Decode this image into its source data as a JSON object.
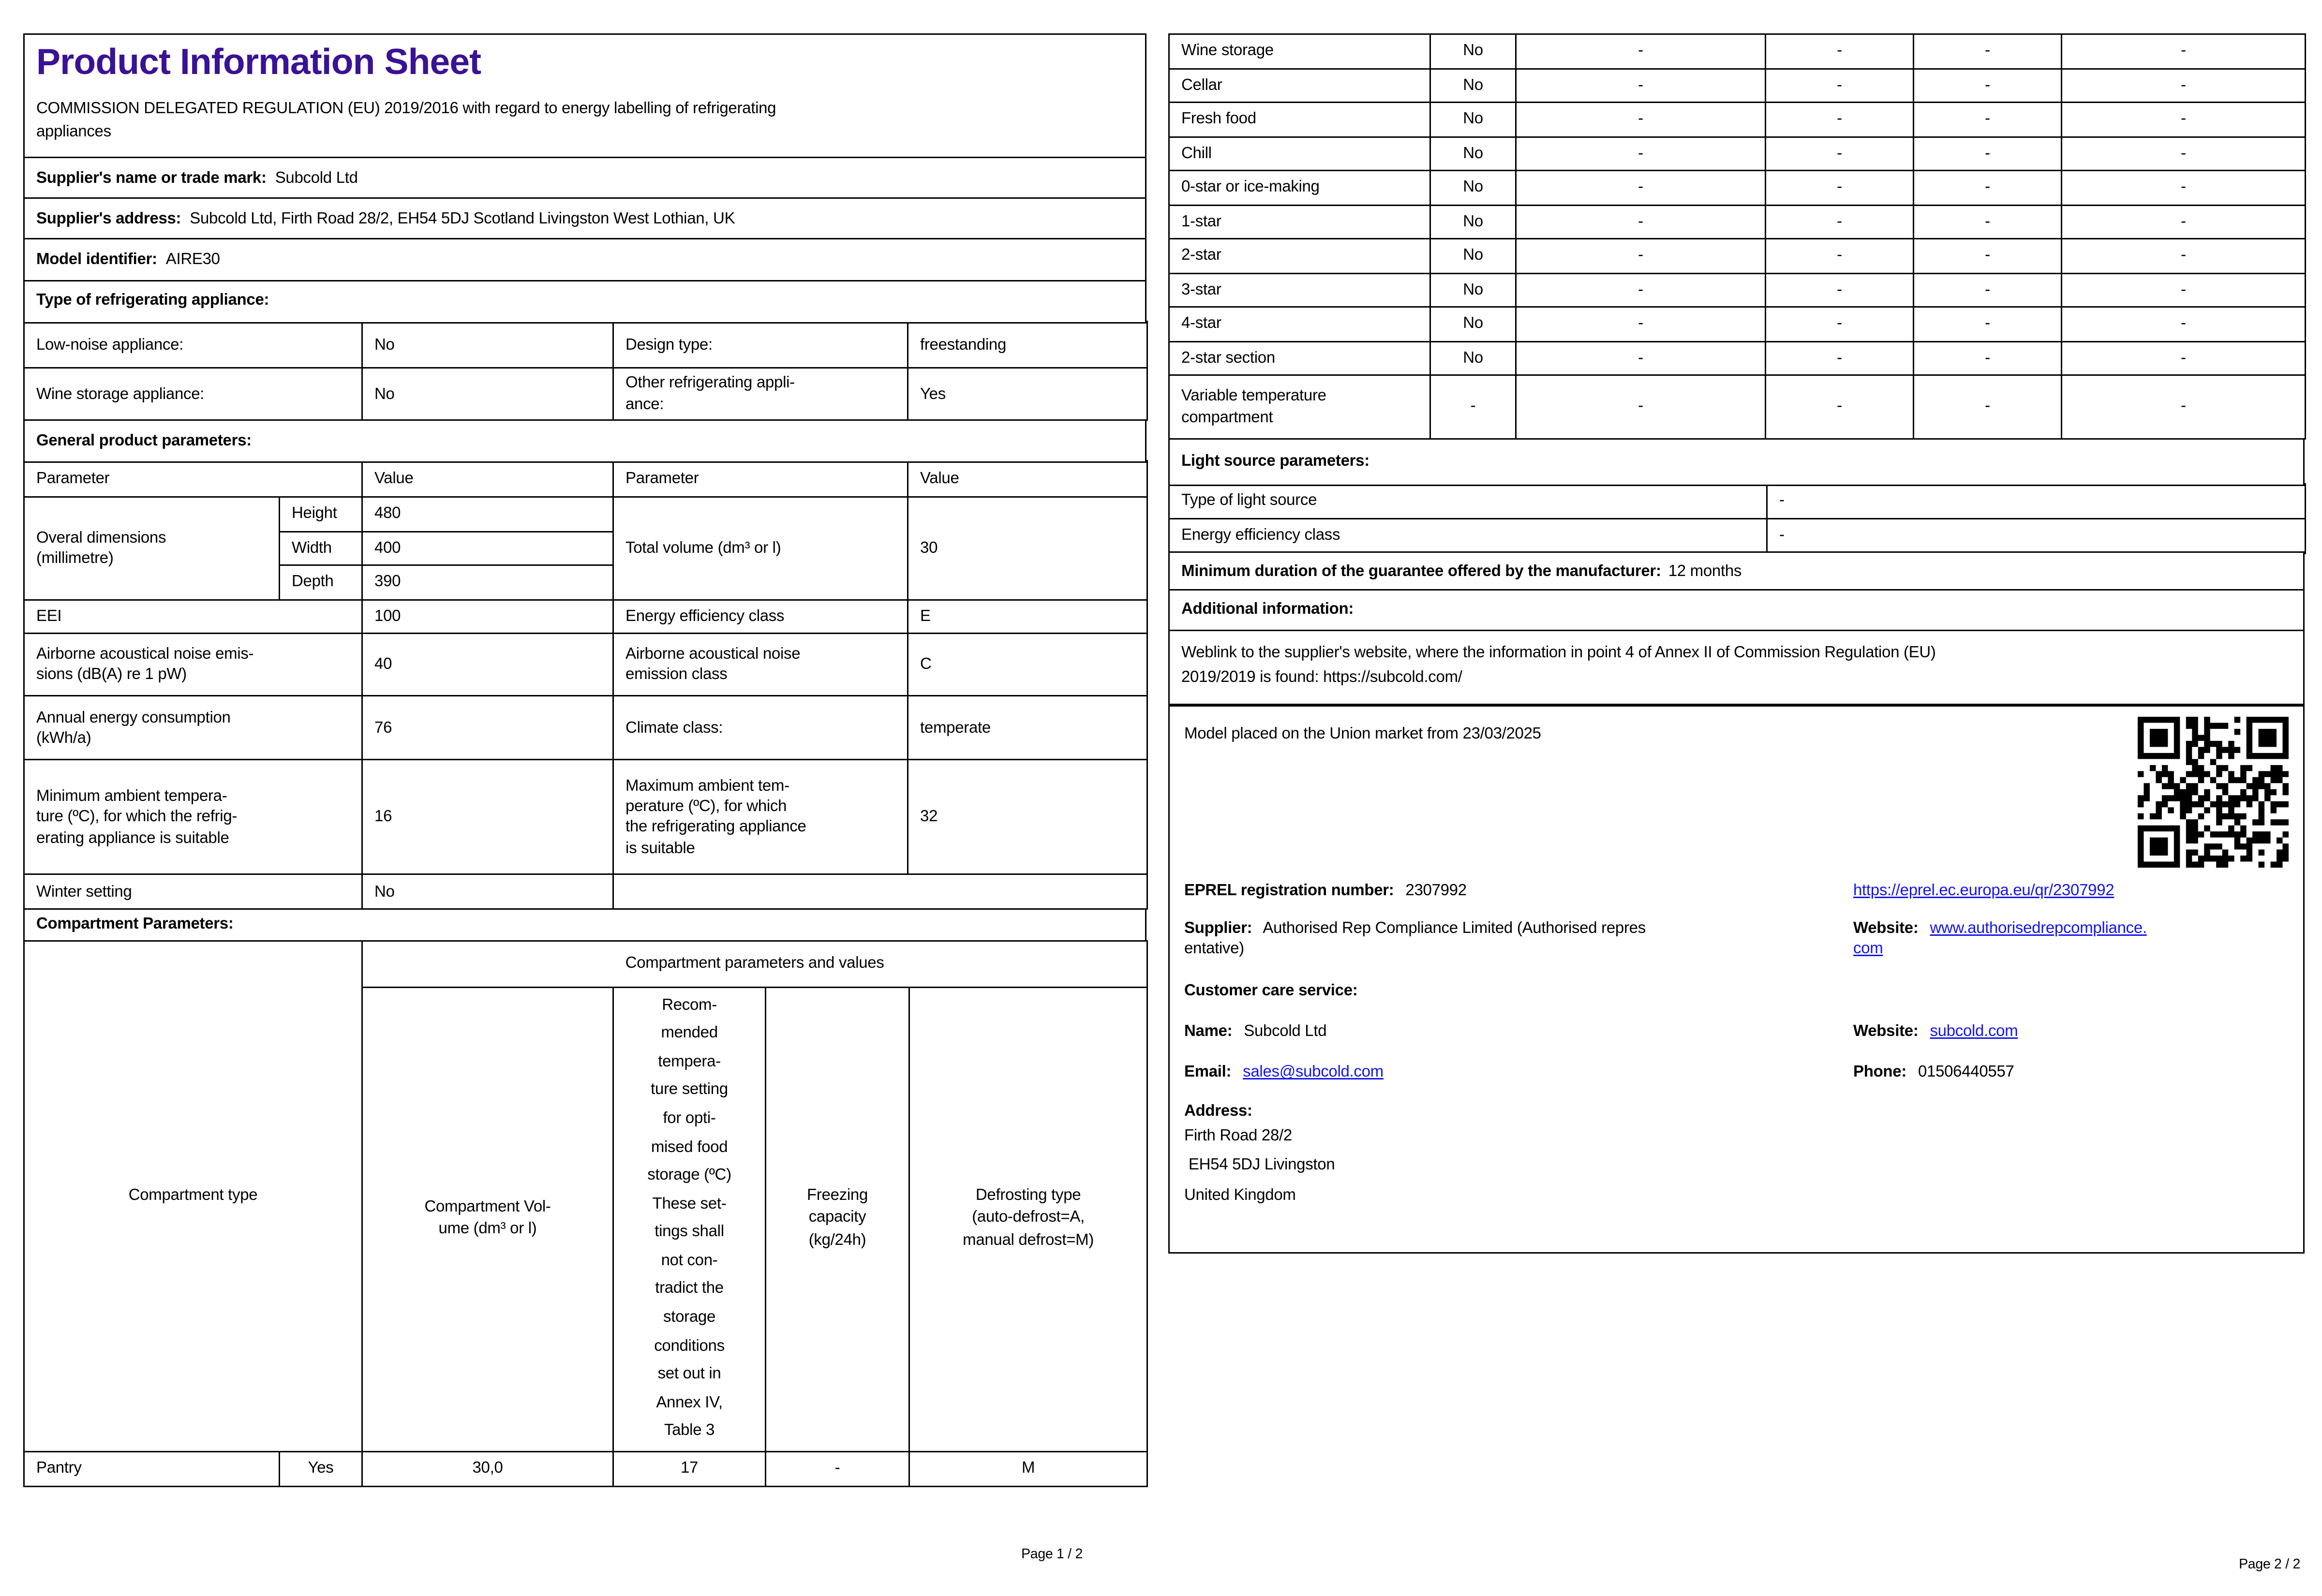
{
  "colors": {
    "title": "#3a1295",
    "link": "#1414ee",
    "border": "#000000"
  },
  "page1": {
    "title": "Product Information Sheet",
    "regulation": "COMMISSION DELEGATED REGULATION (EU) 2019/2016 with regard to energy labelling of refrigerating\nappliances",
    "supplier_name": {
      "label": "Supplier's name or trade mark:",
      "value": "Subcold Ltd"
    },
    "supplier_address": {
      "label": "Supplier's address:",
      "value": "Subcold Ltd, Firth Road 28/2, EH54 5DJ Scotland Livingston West Lothian, UK"
    },
    "model_identifier": {
      "label": "Model identifier:",
      "value": "AIRE30"
    },
    "type_heading": "Type of refrigerating appliance:",
    "type_table": {
      "rows": [
        {
          "p1": "Low-noise appliance:",
          "v1": "No",
          "p2": "Design type:",
          "v2": "freestanding"
        },
        {
          "p1": "Wine storage appliance:",
          "v1": "No",
          "p2": "Other refrigerating appli-\nance:",
          "v2": "Yes"
        }
      ]
    },
    "general_heading": "General product parameters:",
    "general_table": {
      "headers": [
        "Parameter",
        "Value",
        "Parameter",
        "Value"
      ],
      "dimensions": {
        "label": "Overal dimensions\n(millimetre)",
        "rows": [
          {
            "k": "Height",
            "v": "480"
          },
          {
            "k": "Width",
            "v": "400"
          },
          {
            "k": "Depth",
            "v": "390"
          }
        ],
        "p2": "Total volume (dm³ or l)",
        "v2": "30"
      },
      "rows": [
        {
          "p1": "EEI",
          "v1": "100",
          "p2": "Energy efficiency class",
          "v2": "E"
        },
        {
          "p1": "Airborne acoustical noise emis-\nsions (dB(A) re 1 pW)",
          "v1": "40",
          "p2": "Airborne acoustical noise\nemission class",
          "v2": "C"
        },
        {
          "p1": "Annual energy consumption\n(kWh/a)",
          "v1": "76",
          "p2": "Climate class:",
          "v2": "temperate"
        },
        {
          "p1": "Minimum ambient tempera-\nture (ºC), for which the refrig-\nerating appliance is suitable",
          "v1": "16",
          "p2": "Maximum ambient tem-\nperature (ºC), for which\nthe refrigerating appliance\nis suitable",
          "v2": "32"
        },
        {
          "p1": "Winter setting",
          "v1": "No",
          "p2": "",
          "v2": ""
        }
      ]
    },
    "compartment_heading": "Compartment Parameters:",
    "compartment_table": {
      "type_header": "Compartment type",
      "group_header": "Compartment parameters and values",
      "col_headers": [
        "Compartment Vol-\nume (dm³ or l)",
        "Recom-\nmended\ntempera-\nture setting\nfor opti-\nmised food\nstorage (ºC)\nThese set-\ntings shall\nnot con-\ntradict the\nstorage\nconditions\nset out in\nAnnex IV,\nTable 3",
        "Freezing\ncapacity\n(kg/24h)",
        "Defrosting type\n(auto-defrost=A,\nmanual defrost=M)"
      ],
      "row": {
        "type": "Pantry",
        "present": "Yes",
        "volume": "30,0",
        "temp": "17",
        "freezing": "-",
        "defrost": "M"
      }
    },
    "footer": "Page 1 / 2"
  },
  "page2": {
    "compartments_table": {
      "rows": [
        {
          "label": "Wine storage",
          "status": "No",
          "d": [
            "-",
            "-",
            "-",
            "-"
          ]
        },
        {
          "label": "Cellar",
          "status": "No",
          "d": [
            "-",
            "-",
            "-",
            "-"
          ]
        },
        {
          "label": "Fresh food",
          "status": "No",
          "d": [
            "-",
            "-",
            "-",
            "-"
          ]
        },
        {
          "label": "Chill",
          "status": "No",
          "d": [
            "-",
            "-",
            "-",
            "-"
          ]
        },
        {
          "label": "0-star or ice-making",
          "status": "No",
          "d": [
            "-",
            "-",
            "-",
            "-"
          ]
        },
        {
          "label": "1-star",
          "status": "No",
          "d": [
            "-",
            "-",
            "-",
            "-"
          ]
        },
        {
          "label": "2-star",
          "status": "No",
          "d": [
            "-",
            "-",
            "-",
            "-"
          ]
        },
        {
          "label": "3-star",
          "status": "No",
          "d": [
            "-",
            "-",
            "-",
            "-"
          ]
        },
        {
          "label": "4-star",
          "status": "No",
          "d": [
            "-",
            "-",
            "-",
            "-"
          ]
        },
        {
          "label": "2-star section",
          "status": "No",
          "d": [
            "-",
            "-",
            "-",
            "-"
          ]
        },
        {
          "label": "Variable temperature\ncompartment",
          "status": "-",
          "d": [
            "-",
            "-",
            "-",
            "-"
          ]
        }
      ]
    },
    "light_heading": "Light source parameters:",
    "light_rows": [
      {
        "label": "Type of light source",
        "value": "-"
      },
      {
        "label": "Energy efficiency class",
        "value": "-"
      }
    ],
    "guarantee": {
      "label": "Minimum duration of the guarantee offered by the manufacturer:",
      "value": "12 months"
    },
    "additional_heading": "Additional information:",
    "weblink": {
      "text": "Weblink to the supplier's website, where the information in point 4 of Annex II of Commission Regulation (EU)\n2019/2019 is found: ",
      "url": "https://subcold.com/"
    },
    "info_box": {
      "market_line": "Model placed on the Union market from 23/03/2025",
      "eprel": {
        "label": "EPREL registration number:",
        "value": "2307992",
        "link": "https://eprel.ec.europa.eu/qr/2307992"
      },
      "supplier": {
        "label": "Supplier:",
        "value": "Authorised Rep Compliance Limited (Authorised repres\nentative)"
      },
      "supplier_website": {
        "label": "Website:",
        "link": "www.authorisedrepcompliance.\ncom"
      },
      "customer_care_heading": "Customer care service:",
      "name": {
        "label": "Name:",
        "value": "Subcold Ltd"
      },
      "care_website": {
        "label": "Website:",
        "link": "subcold.com"
      },
      "email": {
        "label": "Email:",
        "link": "sales@subcold.com"
      },
      "phone": {
        "label": "Phone:",
        "value": "01506440557"
      },
      "address": {
        "label": "Address:",
        "lines": "Firth Road 28/2\n EH54 5DJ Livingston\nUnited Kingdom"
      }
    },
    "footer": "Page 2 / 2"
  }
}
